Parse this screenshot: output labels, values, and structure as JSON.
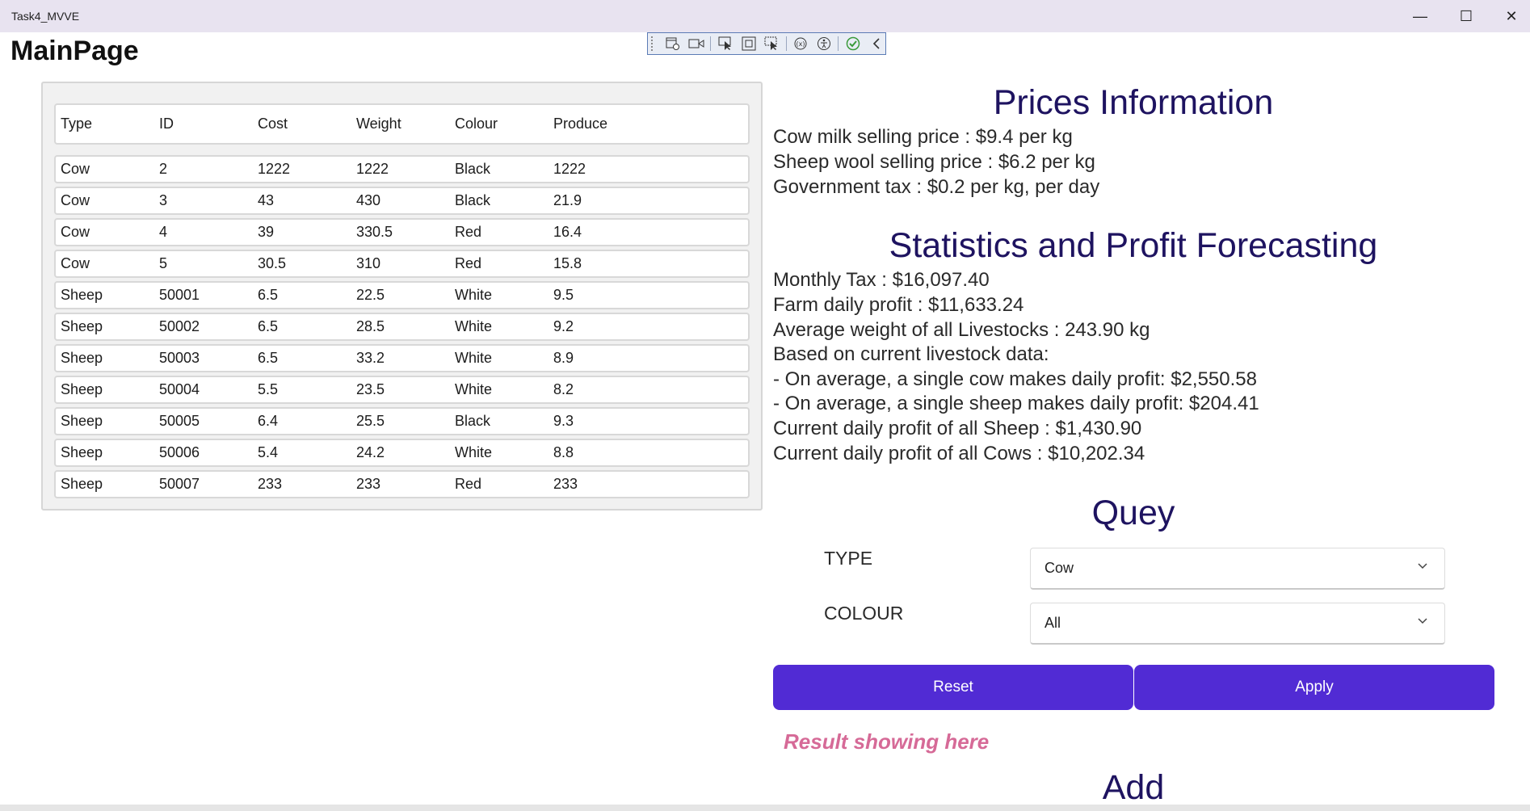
{
  "window": {
    "title": "Task4_MVVE",
    "minimize_glyph": "—",
    "maximize_glyph": "☐",
    "close_glyph": "✕"
  },
  "page_title": "MainPage",
  "debug_toolbar": {
    "icons": [
      "live-visual-tree-icon",
      "record-icon",
      "select-element-icon",
      "display-layout-icon",
      "track-focus-icon",
      "binding-failures-icon",
      "accessibility-icon",
      "check-icon",
      "collapse-icon"
    ]
  },
  "grid": {
    "columns": [
      "Type",
      "ID",
      "Cost",
      "Weight",
      "Colour",
      "Produce"
    ],
    "rows": [
      [
        "Cow",
        "2",
        "1222",
        "1222",
        "Black",
        "1222"
      ],
      [
        "Cow",
        "3",
        "43",
        "430",
        "Black",
        "21.9"
      ],
      [
        "Cow",
        "4",
        "39",
        "330.5",
        "Red",
        "16.4"
      ],
      [
        "Cow",
        "5",
        "30.5",
        "310",
        "Red",
        "15.8"
      ],
      [
        "Sheep",
        "50001",
        "6.5",
        "22.5",
        "White",
        "9.5"
      ],
      [
        "Sheep",
        "50002",
        "6.5",
        "28.5",
        "White",
        "9.2"
      ],
      [
        "Sheep",
        "50003",
        "6.5",
        "33.2",
        "White",
        "8.9"
      ],
      [
        "Sheep",
        "50004",
        "5.5",
        "23.5",
        "White",
        "8.2"
      ],
      [
        "Sheep",
        "50005",
        "6.4",
        "25.5",
        "Black",
        "9.3"
      ],
      [
        "Sheep",
        "50006",
        "5.4",
        "24.2",
        "White",
        "8.8"
      ],
      [
        "Sheep",
        "50007",
        "233",
        "233",
        "Red",
        "233"
      ]
    ]
  },
  "prices": {
    "heading": "Prices Information",
    "lines": [
      "Cow milk selling price :  $9.4 per kg",
      "Sheep wool selling price :  $6.2 per kg",
      "Government tax :  $0.2 per kg, per day"
    ]
  },
  "stats": {
    "heading": "Statistics and Profit Forecasting",
    "lines": [
      "Monthly Tax : $16,097.40",
      "Farm daily profit : $11,633.24",
      "Average weight of all Livestocks : 243.90 kg",
      "Based on current livestock data:",
      "- On average, a single cow makes daily profit: $2,550.58",
      "- On average, a single sheep makes daily profit: $204.41",
      "Current daily profit of all Sheep : $1,430.90",
      "Current daily profit of all Cows : $10,202.34"
    ]
  },
  "query": {
    "heading": "Quey",
    "type_label": "TYPE",
    "type_value": "Cow",
    "colour_label": "COLOUR",
    "colour_value": "All",
    "reset_label": "Reset",
    "apply_label": "Apply",
    "result_text": "Result showing here"
  },
  "add": {
    "heading": "Add"
  }
}
